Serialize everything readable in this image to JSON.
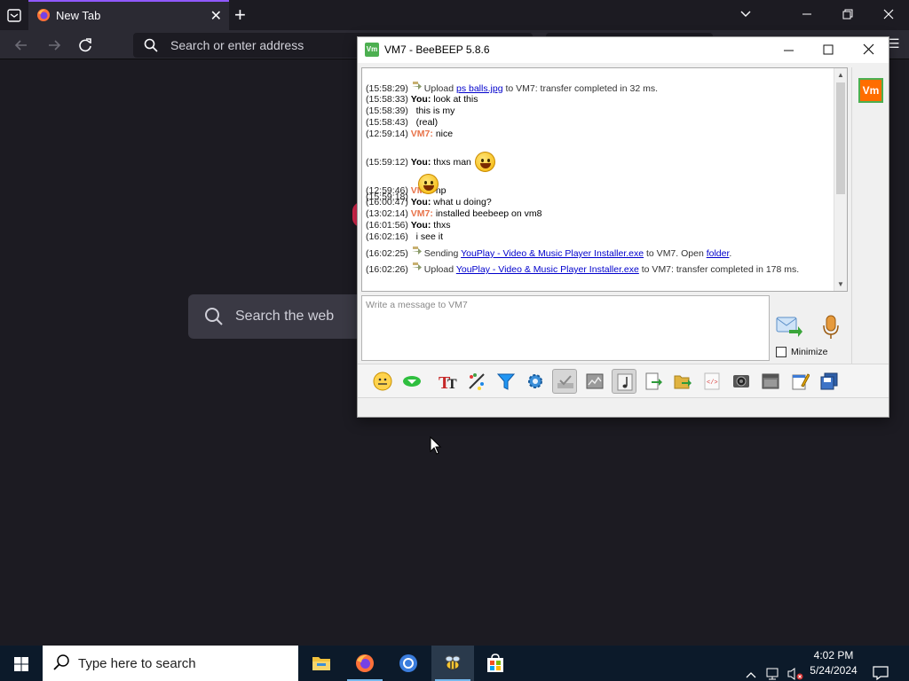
{
  "browser": {
    "tab_title": "New Tab",
    "address_placeholder": "Search or enter address",
    "web_search_placeholder": "Search the web"
  },
  "beebeep": {
    "window_title": "VM7 - BeeBEEP 5.8.6",
    "app_icon_text": "Vm",
    "avatar_text": "Vm",
    "input_placeholder": "Write a message to VM7",
    "minimize_label": "Minimize",
    "messages": [
      {
        "time": "(15:58:29)",
        "pre": "Upload ",
        "link": "ps balls.jpg",
        "post": " to VM7: transfer completed in 32 ms."
      },
      {
        "time": "(15:58:33)",
        "sender": "You:",
        "text": "look at this"
      },
      {
        "time": "(15:58:39)",
        "text": "this is my"
      },
      {
        "time": "(15:58:43)",
        "text": "(real)"
      },
      {
        "time": "(12:59:14)",
        "sender": "VM7:",
        "text": "nice"
      },
      {
        "time": "(15:59:12)",
        "sender": "You:",
        "text": "thxs man"
      },
      {
        "time": "(15:59:18)"
      },
      {
        "time": "(12:59:46)",
        "sender": "VM7:",
        "text": "np"
      },
      {
        "time": "(16:00:47)",
        "sender": "You:",
        "text": "what u doing?"
      },
      {
        "time": "(13:02:14)",
        "sender": "VM7:",
        "text": "installed beebeep on vm8"
      },
      {
        "time": "(16:01:56)",
        "sender": "You:",
        "text": "thxs"
      },
      {
        "time": "(16:02:16)",
        "text": "i see it"
      },
      {
        "time": "(16:02:25)",
        "pre": "Sending ",
        "link": "YouPlay - Video & Music Player Installer.exe",
        "post": " to VM7. Open ",
        "link2": "folder",
        "post2": "."
      },
      {
        "time": "(16:02:26)",
        "pre": "Upload ",
        "link": "YouPlay - Video & Music Player Installer.exe",
        "post": " to VM7: transfer completed in 178 ms."
      }
    ]
  },
  "taskbar": {
    "search_placeholder": "Type here to search",
    "time": "4:02 PM",
    "date": "5/24/2024"
  },
  "colors": {
    "accent": "#9059ff",
    "vm7_sender": "#e8734a",
    "link": "#0000cc",
    "taskbar": "#0c1a2a"
  }
}
